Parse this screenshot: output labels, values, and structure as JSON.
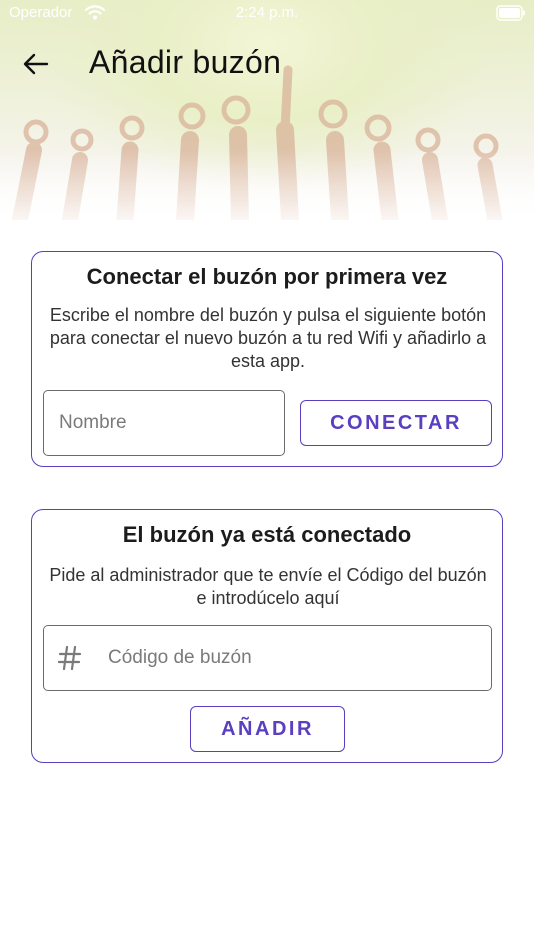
{
  "status_bar": {
    "carrier": "Operador",
    "time": "2:24 p.m.",
    "wifi_icon": "wifi-icon",
    "battery_icon": "battery-icon"
  },
  "app_bar": {
    "back_icon": "arrow-back-icon",
    "title": "Añadir buzón"
  },
  "connect_card": {
    "title": "Conectar el buzón por primera vez",
    "description": "Escribe el nombre del buzón y pulsa el siguiente botón para conectar el nuevo buzón a tu red Wifi y añadirlo a esta app.",
    "name_input": {
      "placeholder": "Nombre",
      "value": ""
    },
    "connect_button": "CONECTAR"
  },
  "existing_card": {
    "title": "El buzón ya está conectado",
    "description": "Pide al administrador que te envíe el Código del buzón e introdúcelo aquí",
    "code_input": {
      "placeholder": "Código de buzón",
      "value": "",
      "icon": "hash-icon"
    },
    "add_button": "AÑADIR"
  },
  "colors": {
    "accent": "#5a3fc0",
    "input_border": "#6b6b6b",
    "text": "#1c1c1c"
  }
}
